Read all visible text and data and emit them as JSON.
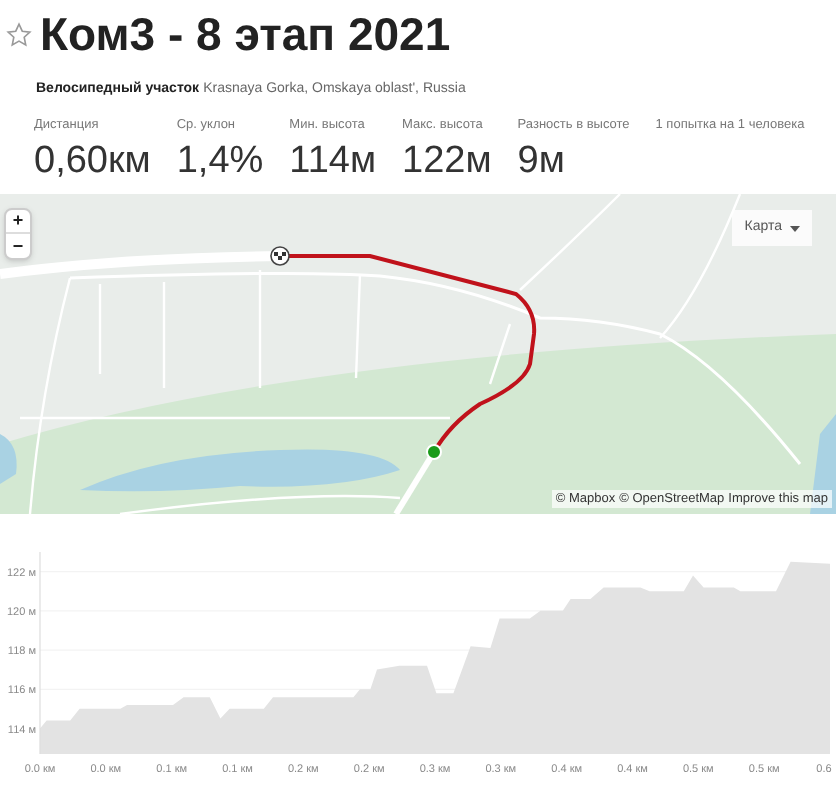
{
  "title": "Ком3 - 8 этап 2021",
  "segment": {
    "type_label": "Велосипедный участок",
    "location": "Krasnaya Gorka, Omskaya oblast', Russia"
  },
  "stats": [
    {
      "label": "Дистанция",
      "value": "0,60км"
    },
    {
      "label": "Ср. уклон",
      "value": "1,4%"
    },
    {
      "label": "Мин. высота",
      "value": "114м"
    },
    {
      "label": "Макс. высота",
      "value": "122м"
    },
    {
      "label": "Разность в высоте",
      "value": "9м"
    },
    {
      "label": "1 попытка на 1 человека"
    }
  ],
  "map": {
    "zoom_in": "+",
    "zoom_out": "−",
    "layer_menu": "Карта",
    "attribution": [
      "© Mapbox",
      "© OpenStreetMap",
      "Improve this map"
    ]
  },
  "elevation": {
    "chart_data": {
      "type": "area",
      "grid": true,
      "xlim": [
        0,
        0.6
      ],
      "ylim": [
        112.7,
        123
      ],
      "xticks": [
        {
          "value": 0,
          "label": "0.0 км"
        },
        {
          "value": 0.05,
          "label": "0.0 км"
        },
        {
          "value": 0.1,
          "label": "0.1 км"
        },
        {
          "value": 0.15,
          "label": "0.1 км"
        },
        {
          "value": 0.2,
          "label": "0.2 км"
        },
        {
          "value": 0.25,
          "label": "0.2 км"
        },
        {
          "value": 0.3,
          "label": "0.3 км"
        },
        {
          "value": 0.35,
          "label": "0.3 км"
        },
        {
          "value": 0.4,
          "label": "0.4 км"
        },
        {
          "value": 0.45,
          "label": "0.4 км"
        },
        {
          "value": 0.5,
          "label": "0.5 км"
        },
        {
          "value": 0.55,
          "label": "0.5 км"
        },
        {
          "value": 0.6,
          "label": "0.6"
        }
      ],
      "yticks": [
        {
          "value": 114,
          "label": "114 м"
        },
        {
          "value": 116,
          "label": "116 м"
        },
        {
          "value": 118,
          "label": "118 м"
        },
        {
          "value": 120,
          "label": "120 м"
        },
        {
          "value": 122,
          "label": "122 м"
        }
      ],
      "x": [
        0,
        0.005,
        0.023,
        0.03,
        0.061,
        0.066,
        0.101,
        0.109,
        0.129,
        0.137,
        0.144,
        0.17,
        0.177,
        0.238,
        0.243,
        0.251,
        0.256,
        0.273,
        0.294,
        0.301,
        0.314,
        0.327,
        0.342,
        0.349,
        0.372,
        0.38,
        0.397,
        0.403,
        0.418,
        0.428,
        0.456,
        0.463,
        0.489,
        0.496,
        0.504,
        0.527,
        0.532,
        0.559,
        0.57,
        0.6
      ],
      "series": [
        {
          "color": "#e3e3e3",
          "values": [
            114.0,
            114.4,
            114.4,
            115.0,
            115.0,
            115.2,
            115.2,
            115.6,
            115.6,
            114.5,
            115.0,
            115.0,
            115.6,
            115.6,
            116.0,
            116.0,
            117.0,
            117.2,
            117.2,
            115.8,
            115.8,
            118.2,
            118.1,
            119.6,
            119.6,
            120.0,
            120.0,
            120.6,
            120.6,
            121.2,
            121.2,
            121.0,
            121.0,
            121.8,
            121.2,
            121.2,
            121.0,
            121.0,
            122.5,
            122.4
          ]
        }
      ]
    }
  }
}
